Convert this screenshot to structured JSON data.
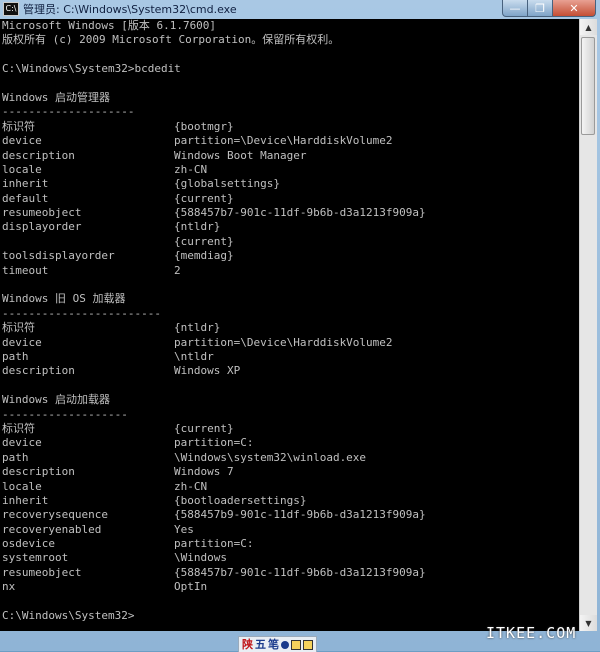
{
  "window": {
    "title": "管理员: C:\\Windows\\System32\\cmd.exe",
    "app_icon_label": "C:\\",
    "minimize_symbol": "—",
    "maximize_symbol": "❐",
    "close_symbol": "✕"
  },
  "console": {
    "lines": [
      {
        "text": "Microsoft Windows [版本 6.1.7600]"
      },
      {
        "text": "版权所有 (c) 2009 Microsoft Corporation。保留所有权利。"
      },
      {
        "text": ""
      },
      {
        "text": "C:\\Windows\\System32>bcdedit"
      },
      {
        "text": ""
      },
      {
        "text": "Windows 启动管理器"
      },
      {
        "text": "--------------------"
      },
      {
        "key": "标识符",
        "value": "{bootmgr}"
      },
      {
        "key": "device",
        "value": "partition=\\Device\\HarddiskVolume2"
      },
      {
        "key": "description",
        "value": "Windows Boot Manager"
      },
      {
        "key": "locale",
        "value": "zh-CN"
      },
      {
        "key": "inherit",
        "value": "{globalsettings}"
      },
      {
        "key": "default",
        "value": "{current}"
      },
      {
        "key": "resumeobject",
        "value": "{588457b7-901c-11df-9b6b-d3a1213f909a}"
      },
      {
        "key": "displayorder",
        "value": "{ntldr}"
      },
      {
        "key": "",
        "value": "{current}"
      },
      {
        "key": "toolsdisplayorder",
        "value": "{memdiag}"
      },
      {
        "key": "timeout",
        "value": "2"
      },
      {
        "text": ""
      },
      {
        "text": "Windows 旧 OS 加载器"
      },
      {
        "text": "------------------------"
      },
      {
        "key": "标识符",
        "value": "{ntldr}"
      },
      {
        "key": "device",
        "value": "partition=\\Device\\HarddiskVolume2"
      },
      {
        "key": "path",
        "value": "\\ntldr"
      },
      {
        "key": "description",
        "value": "Windows XP"
      },
      {
        "text": ""
      },
      {
        "text": "Windows 启动加载器"
      },
      {
        "text": "-------------------"
      },
      {
        "key": "标识符",
        "value": "{current}"
      },
      {
        "key": "device",
        "value": "partition=C:"
      },
      {
        "key": "path",
        "value": "\\Windows\\system32\\winload.exe"
      },
      {
        "key": "description",
        "value": "Windows 7"
      },
      {
        "key": "locale",
        "value": "zh-CN"
      },
      {
        "key": "inherit",
        "value": "{bootloadersettings}"
      },
      {
        "key": "recoverysequence",
        "value": "{588457b9-901c-11df-9b6b-d3a1213f909a}"
      },
      {
        "key": "recoveryenabled",
        "value": "Yes"
      },
      {
        "key": "osdevice",
        "value": "partition=C:"
      },
      {
        "key": "systemroot",
        "value": "\\Windows"
      },
      {
        "key": "resumeobject",
        "value": "{588457b7-901c-11df-9b6b-d3a1213f909a}"
      },
      {
        "key": "nx",
        "value": "OptIn"
      },
      {
        "text": ""
      },
      {
        "text": "C:\\Windows\\System32>"
      }
    ]
  },
  "scrollbar": {
    "up_symbol": "▲",
    "down_symbol": "▼"
  },
  "ime_bar": {
    "mode_label": "陕",
    "input_label": "五",
    "punct_label": "笔",
    "icon_names": [
      "dot-icon",
      "keyboard-icon",
      "tools-icon"
    ]
  },
  "watermark": {
    "text": "ITKEE.COM"
  }
}
